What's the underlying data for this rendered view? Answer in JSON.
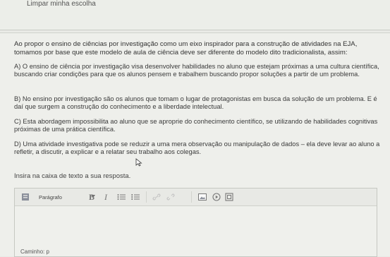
{
  "top": {
    "clear_choice": "Limpar minha escolha"
  },
  "question": {
    "intro": "Ao propor o ensino de ciências por investigação como um eixo inspirador para a construção de atividades na EJA, tomamos por  base que este modelo de aula de ciência deve ser diferente do modelo dito tradicionalista, assim:",
    "options": [
      "A) O ensino de ciência por investigação visa desenvolver habilidades no aluno que estejam próximas a uma cultura científica, buscando criar condições para que os alunos pensem e trabalhem buscando propor soluções a partir de um problema.",
      "B) No ensino por investigação são os alunos que tomam o lugar de protagonistas em busca da solução de um problema. E é daí que surgem a construção do conhecimento e a liberdade intelectual.",
      "C) Esta abordagem impossibilita ao aluno que se aproprie do conhecimento científico, se utilizando de habilidades cognitivas próximas de uma prática científica.",
      "D) Uma atividade investigativa pode se reduzir a uma mera observação ou manipulação de dados – ela deve levar ao aluno a refletir, a discutir, a explicar e a relatar seu trabalho aos colegas."
    ],
    "prompt": "Insira na caixa de texto a sua resposta."
  },
  "editor": {
    "format_label": "Parágrafo",
    "bold": "B",
    "italic": "I",
    "path": "Caminho: p"
  }
}
